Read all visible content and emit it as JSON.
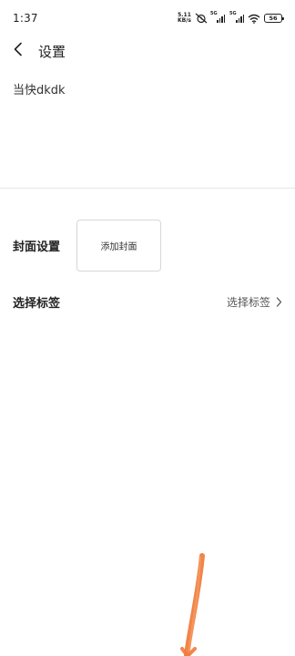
{
  "status_bar": {
    "time": "1:37",
    "speed_value": "5.11",
    "speed_unit": "KB/s",
    "network_tag_1": "5G",
    "network_tag_2": "5G",
    "battery": "56"
  },
  "header": {
    "back_icon": "chevron-left-icon",
    "title": "设置"
  },
  "content": {
    "title_text": "当快dkdk"
  },
  "cover": {
    "label": "封面设置",
    "button_label": "添加封面"
  },
  "tags": {
    "label": "选择标签",
    "action_label": "选择标签",
    "chevron_icon": "chevron-right-icon"
  },
  "colors": {
    "annotation": "#f07a3a",
    "divider": "#e8e8e8"
  }
}
